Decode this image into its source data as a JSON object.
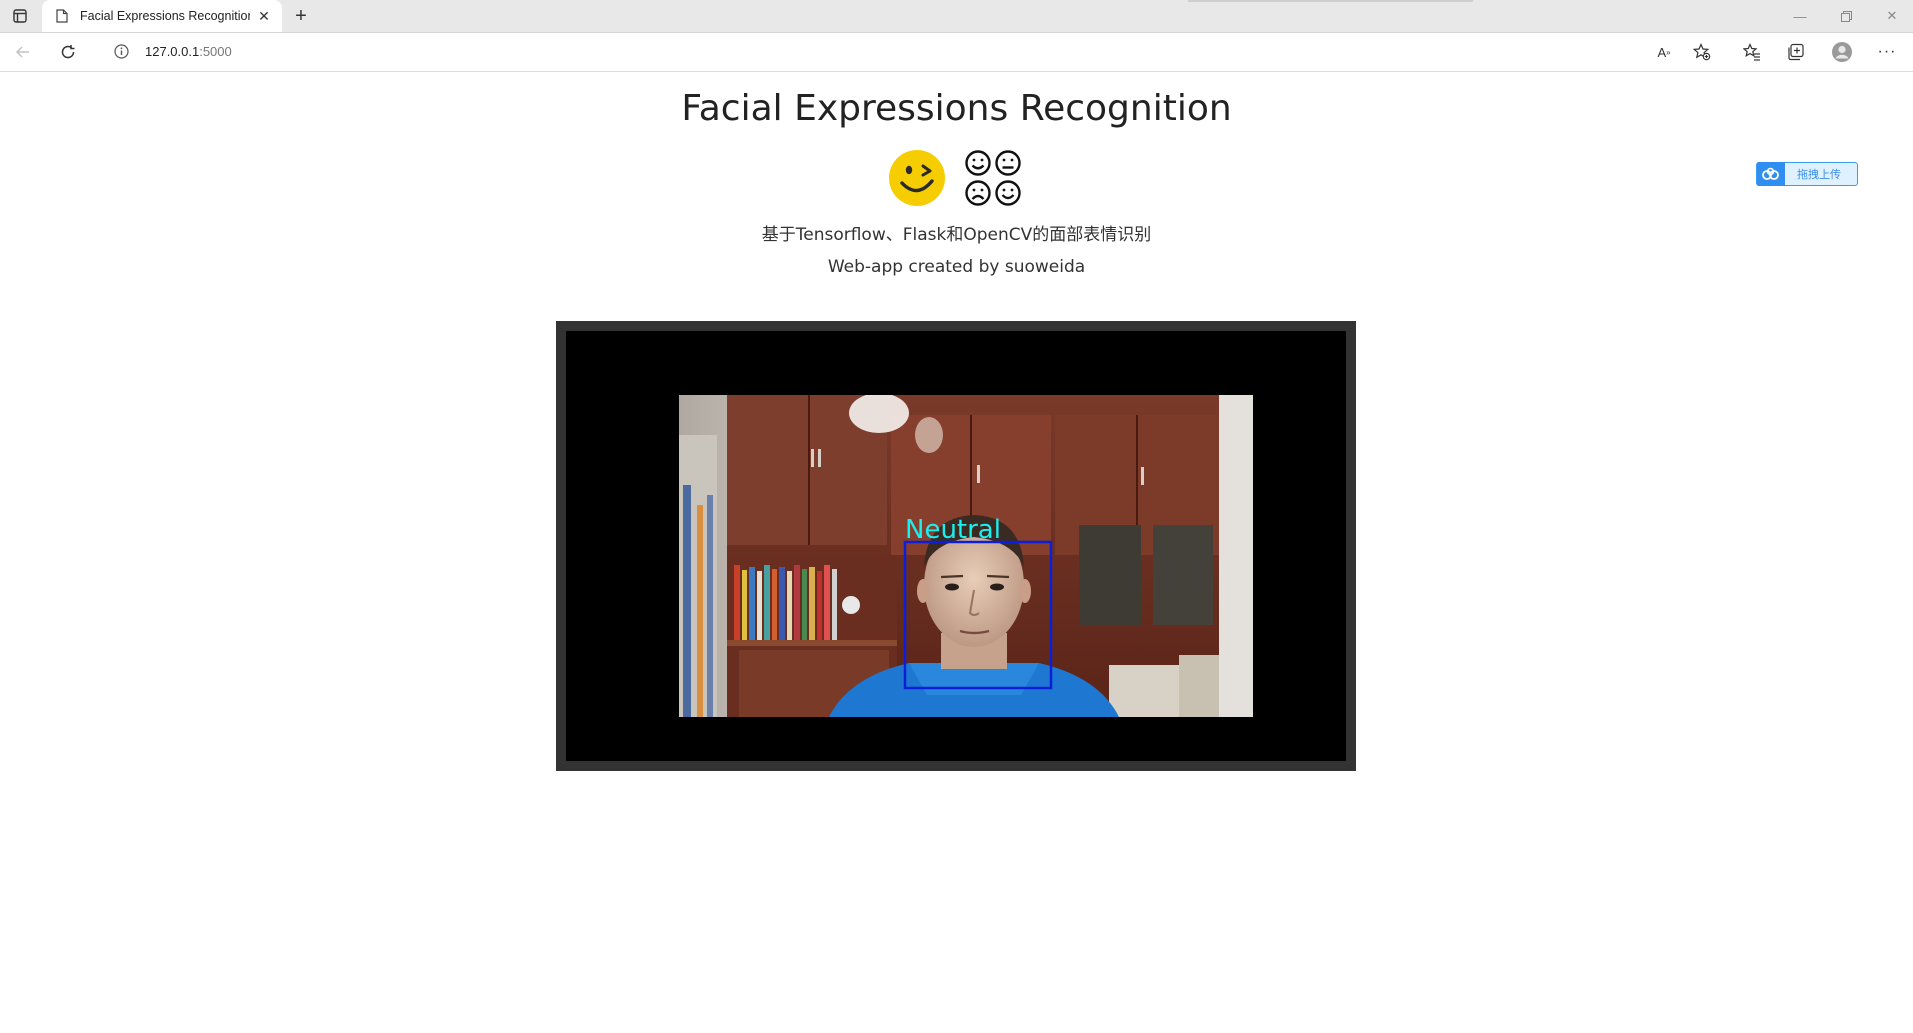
{
  "browser": {
    "tab": {
      "title": "Facial Expressions Recognition"
    },
    "address": {
      "host": "127.0.0.1",
      "port": ":5000"
    },
    "read_aloud_label": "A"
  },
  "page": {
    "title": "Facial Expressions Recognition",
    "subtitle": "基于Tensorflow、Flask和OpenCV的面部表情识别",
    "credit": "Web-app created by suoweida",
    "upload_badge": "拖拽上传"
  },
  "video": {
    "detection_label": "Neutral",
    "box_color": "#0a1fd6",
    "label_color": "#19f0f0"
  },
  "colors": {
    "frame_border": "#333333",
    "emoji_yellow": "#f5cd00"
  },
  "icons": {
    "tab_switcher": "tab-switcher-icon",
    "page": "page-icon",
    "back": "back-arrow-icon",
    "refresh": "refresh-icon",
    "info": "info-icon",
    "favorite": "add-favorite-icon",
    "favorites": "favorites-icon",
    "collections": "collections-icon",
    "profile": "profile-icon",
    "more": "more-icon"
  }
}
